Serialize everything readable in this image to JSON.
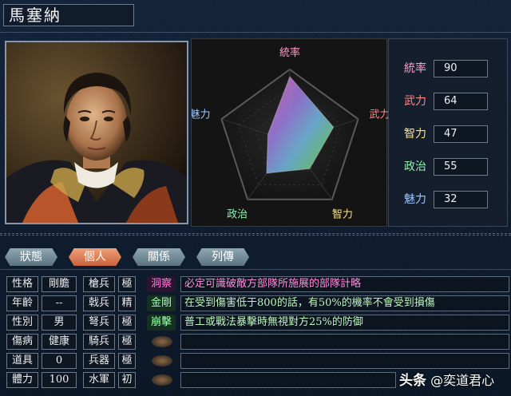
{
  "character": {
    "name": "馬塞納"
  },
  "radar": {
    "labels": {
      "leadership": "統率",
      "force": "武力",
      "intellect": "智力",
      "politics": "政治",
      "charm": "魅力"
    },
    "values": {
      "leadership": 90,
      "force": 64,
      "intellect": 47,
      "politics": 55,
      "charm": 32
    },
    "max": 100
  },
  "stats": [
    {
      "label": "統率",
      "value": "90",
      "color": "#ff9ec8"
    },
    {
      "label": "武力",
      "value": "64",
      "color": "#ff8a8a"
    },
    {
      "label": "智力",
      "value": "47",
      "color": "#ffe67a"
    },
    {
      "label": "政治",
      "value": "55",
      "color": "#8ff0b0"
    },
    {
      "label": "魅力",
      "value": "32",
      "color": "#9cc8ff"
    }
  ],
  "tabs": [
    {
      "label": "狀態",
      "active": false
    },
    {
      "label": "個人",
      "active": true
    },
    {
      "label": "關係",
      "active": false
    },
    {
      "label": "列傳",
      "active": false
    }
  ],
  "personal": [
    {
      "label": "性格",
      "value": "剛膽"
    },
    {
      "label": "年齡",
      "value": "--"
    },
    {
      "label": "性別",
      "value": "男"
    },
    {
      "label": "傷病",
      "value": "健康"
    },
    {
      "label": "道具",
      "value": "0"
    },
    {
      "label": "體力",
      "value": "100"
    }
  ],
  "troops": [
    {
      "label": "槍兵",
      "value": "極"
    },
    {
      "label": "戟兵",
      "value": "精"
    },
    {
      "label": "弩兵",
      "value": "極"
    },
    {
      "label": "騎兵",
      "value": "極"
    },
    {
      "label": "兵器",
      "value": "極"
    },
    {
      "label": "水軍",
      "value": "初"
    }
  ],
  "skills": [
    {
      "name": "洞察",
      "name_color": "#ff7ad8",
      "desc": "必定可識破敵方部隊所施展的部隊計略",
      "desc_color": "#ff8ad8"
    },
    {
      "name": "金剛",
      "name_color": "#9cffb0",
      "desc": "在受到傷害低于800的話，有50%的機率不會受到損傷",
      "desc_color": "#bff5c0"
    },
    {
      "name": "崩擊",
      "name_color": "#9cffb0",
      "desc": "普工或戰法暴擊時無視對方25%的防御",
      "desc_color": "#bff5c0"
    },
    {
      "name": "",
      "name_color": "",
      "desc": "",
      "desc_color": ""
    },
    {
      "name": "",
      "name_color": "",
      "desc": "",
      "desc_color": ""
    },
    {
      "name": "",
      "name_color": "",
      "desc": "",
      "desc_color": ""
    }
  ],
  "watermark": {
    "brand": "头条",
    "handle": "@奕道君心"
  }
}
